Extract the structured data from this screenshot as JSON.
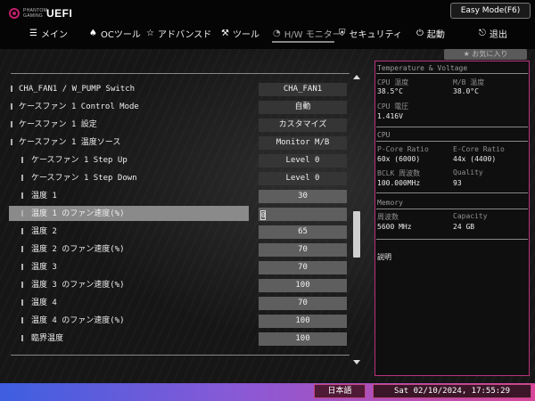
{
  "brand": {
    "line1": "PHANTOM",
    "line2": "GAMING",
    "product": "UEFI"
  },
  "easy_mode_label": "Easy Mode(F6)",
  "nav": {
    "tabs": [
      {
        "icon": "☰",
        "label": "メイン"
      },
      {
        "icon": "♠",
        "label": "OCツール"
      },
      {
        "icon": "☆",
        "label": "アドバンスド"
      },
      {
        "icon": "⚒",
        "label": "ツール"
      },
      {
        "icon": "◔",
        "label": "H/W モニター"
      },
      {
        "icon": "⛨",
        "label": "セキュリティ"
      },
      {
        "icon": "⏻",
        "label": "起動"
      },
      {
        "icon": "⎋",
        "label": "退出"
      }
    ],
    "active_index": 4
  },
  "favorites_label": "★ お気に入り",
  "settings": [
    {
      "label": "CHA_FAN1 / W_PUMP Switch",
      "value": "CHA_FAN1"
    },
    {
      "label": "ケースファン 1 Control Mode",
      "value": "自動"
    },
    {
      "label": "ケースファン 1 設定",
      "value": "カスタマイズ"
    },
    {
      "label": "ケースファン 1 温度ソース",
      "value": "Monitor M/B"
    },
    {
      "label": "ケースファン 1 Step Up",
      "value": "Level 0"
    },
    {
      "label": "ケースファン 1 Step Down",
      "value": "Level 0"
    },
    {
      "label": "温度 1",
      "value": "30"
    },
    {
      "label": "温度 1 のファン速度(%)",
      "value": "0"
    },
    {
      "label": "温度 2",
      "value": "65"
    },
    {
      "label": "温度 2 のファン速度(%)",
      "value": "70"
    },
    {
      "label": "温度 3",
      "value": "70"
    },
    {
      "label": "温度 3 のファン速度(%)",
      "value": "100"
    },
    {
      "label": "温度 4",
      "value": "70"
    },
    {
      "label": "温度 4 のファン速度(%)",
      "value": "100"
    },
    {
      "label": "臨界温度",
      "value": "100"
    }
  ],
  "selected_index": 7,
  "monitor": {
    "section_temp": "Temperature & Voltage",
    "cpu_temp_label": "CPU 温度",
    "cpu_temp_value": "38.5°C",
    "mb_temp_label": "M/B 温度",
    "mb_temp_value": "38.0°C",
    "cpu_volt_label": "CPU 電圧",
    "cpu_volt_value": "1.416V",
    "section_cpu": "CPU",
    "pcore_label": "P-Core Ratio",
    "pcore_value": "60x (6000)",
    "ecore_label": "E-Core Ratio",
    "ecore_value": "44x (4400)",
    "bclk_label": "BCLK 周波数",
    "bclk_value": "100.000MHz",
    "quality_label": "Quality",
    "quality_value": "93",
    "section_mem": "Memory",
    "freq_label": "周波数",
    "freq_value": "5600 MHz",
    "cap_label": "Capacity",
    "cap_value": "24 GB",
    "desc_label": "説明"
  },
  "footer": {
    "language": "日本語",
    "datetime": "Sat 02/10/2024, 17:55:29"
  },
  "colors": {
    "accent": "#c0457f",
    "panel_border": "#b8327d",
    "highlight": "#8a8a8a"
  }
}
